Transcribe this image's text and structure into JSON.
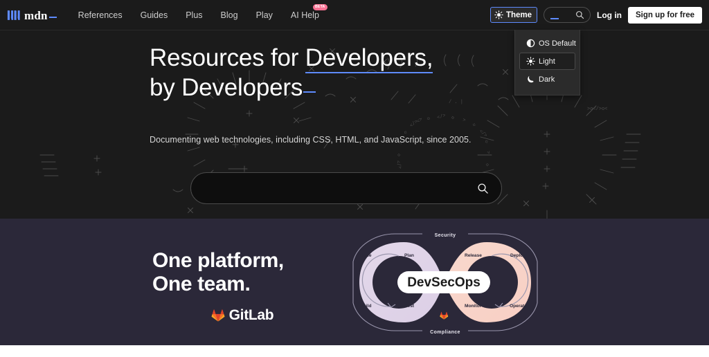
{
  "header": {
    "logo": {
      "text": "mdn",
      "icon": "mdn-logo-mark"
    },
    "nav": [
      {
        "label": "References",
        "badge": null
      },
      {
        "label": "Guides",
        "badge": null
      },
      {
        "label": "Plus",
        "badge": null
      },
      {
        "label": "Blog",
        "badge": null
      },
      {
        "label": "Play",
        "badge": null
      },
      {
        "label": "AI Help",
        "badge": "BETA"
      }
    ],
    "theme_button": {
      "label": "Theme",
      "icon": "sun-icon"
    },
    "search": {
      "value": "",
      "placeholder": "",
      "icon": "search-icon"
    },
    "login_label": "Log in",
    "signup_label": "Sign up for free"
  },
  "theme_menu": {
    "open": true,
    "items": [
      {
        "label": "OS Default",
        "icon": "half-circle-icon",
        "selected": false
      },
      {
        "label": "Light",
        "icon": "sun-icon",
        "selected": true
      },
      {
        "label": "Dark",
        "icon": "moon-icon",
        "selected": false
      }
    ]
  },
  "hero": {
    "title_line1_pre": "Resources for ",
    "title_line1_link": "Developers,",
    "title_line2": "by Developers",
    "subtitle": "Documenting web technologies, including CSS, HTML, and JavaScript, since 2005.",
    "search": {
      "value": "",
      "placeholder": "",
      "icon": "search-icon"
    }
  },
  "ad": {
    "headline_line1": "One platform,",
    "headline_line2": "One team.",
    "brand_name": "GitLab",
    "brand_icon": "gitlab-tanuki-icon",
    "center_label": "DevSecOps",
    "top_label": "Security",
    "bottom_label": "Compliance",
    "stage_labels": {
      "top_left_1": "Code",
      "top_left_2": "Plan",
      "top_right_1": "Release",
      "top_right_2": "Deploy",
      "bottom_left_1": "Build",
      "bottom_left_2": "Test",
      "bottom_right_1": "Monitor",
      "bottom_right_2": "Operate"
    }
  },
  "colors": {
    "header_bg": "#1b1b1b",
    "hero_bg": "#1b1b1b",
    "ad_bg": "#2b2839",
    "accent_blue": "#5e8bff",
    "beta_pink": "#f87394",
    "gitlab_orange": "#fc6d26",
    "loop_left": "#dfd2e6",
    "loop_right": "#f6d4c8"
  }
}
